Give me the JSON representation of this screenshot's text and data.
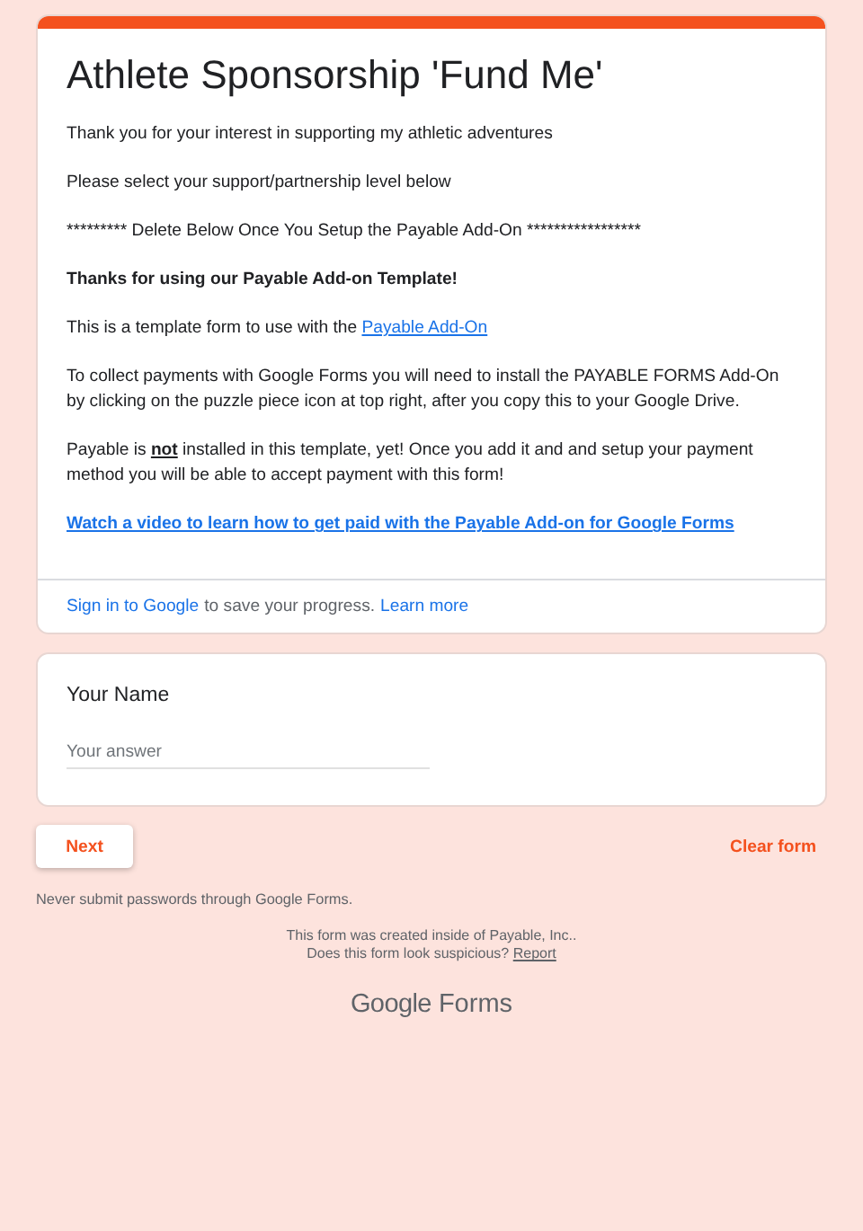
{
  "header": {
    "title": "Athlete Sponsorship 'Fund Me'",
    "paragraphs": [
      {
        "kind": "text",
        "text": "Thank you for your interest in supporting my athletic adventures"
      },
      {
        "kind": "text",
        "text": "Please select your support/partnership level below"
      },
      {
        "kind": "text",
        "text": "********* Delete Below Once You Setup the Payable Add-On *****************"
      },
      {
        "kind": "bold",
        "text": "Thanks for using our Payable Add-on Template!"
      },
      {
        "kind": "text_link",
        "text": "This is a template form to use with the",
        "link": "Payable Add-On"
      },
      {
        "kind": "text",
        "text": "To collect payments with Google Forms you will need to install the PAYABLE FORMS Add-On by clicking on the puzzle piece icon at top right, after you copy this to your Google Drive."
      },
      {
        "kind": "rich",
        "text": "Payable is **not** installed in this template, yet! Once you add it and and setup your payment method you will be able to accept payment with this form!"
      },
      {
        "kind": "link",
        "text": "Watch a video to learn how to get paid with the Payable Add-on for Google Forms"
      }
    ],
    "sign_in": {
      "link": "Sign in to Google",
      "text": "to save your progress.",
      "learn_more": "Learn more"
    }
  },
  "question": {
    "title": "Your Name",
    "placeholder": "Your answer"
  },
  "buttons": {
    "next": "Next",
    "clear": "Clear form"
  },
  "notice": "Never submit passwords through Google Forms.",
  "footer": {
    "created": "This form was created inside of Payable, Inc..",
    "suspicious": "Does this form look suspicious?",
    "report": "Report",
    "logo_google": "Google",
    "logo_forms": "Forms"
  }
}
